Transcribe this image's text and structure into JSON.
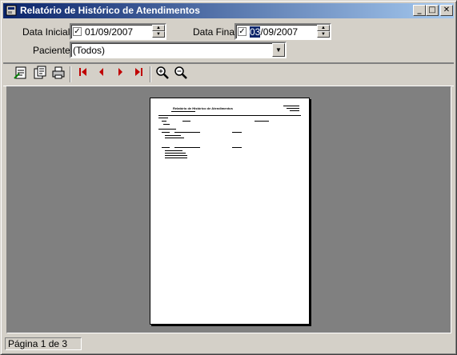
{
  "window": {
    "title": "Relatório de Histórico de Atendimentos",
    "minimize": "_",
    "maximize": "□",
    "close": "✕"
  },
  "filters": {
    "data_inicial_label": "Data Inicial:",
    "data_inicial_value": "01/09/2007",
    "data_inicial_checked": "✓",
    "data_final_label": "Data Final:",
    "data_final_value_selected": "03",
    "data_final_value_rest": "/09/2007",
    "data_final_checked": "✓",
    "paciente_label": "Paciente:",
    "paciente_value": "(Todos)"
  },
  "toolbar": {
    "icons": [
      "fit-page-icon",
      "page-setup-icon",
      "print-icon",
      "first-page-icon",
      "prev-page-icon",
      "next-page-icon",
      "last-page-icon",
      "zoom-in-icon",
      "zoom-out-icon"
    ],
    "nav_color": "#c00000"
  },
  "report_page": {
    "title": "Relatório de Histórico de Atendimentos"
  },
  "status": {
    "page_text": "Página 1 de 3"
  },
  "colors": {
    "titlebar_start": "#0a246a",
    "titlebar_end": "#a6caf0",
    "face": "#d4d0c8",
    "preview_bg": "#808080"
  }
}
